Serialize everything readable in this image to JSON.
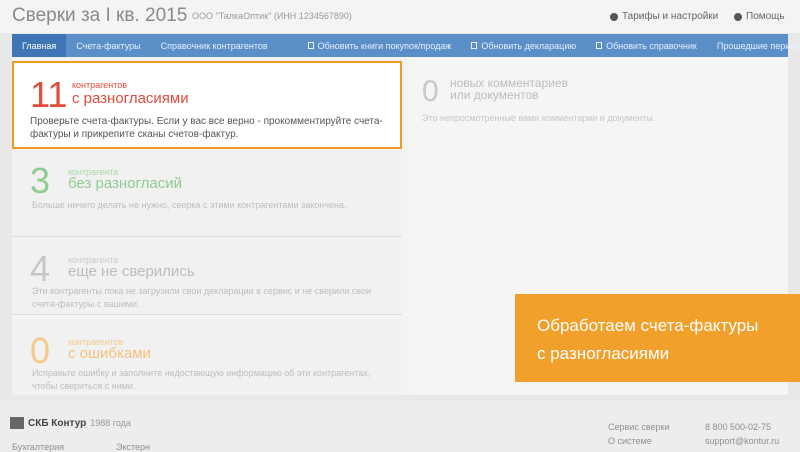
{
  "header": {
    "title": "Сверки за I кв. 2015",
    "org": "ООО \"ТалкаОптик\" (ИНН 1234567890)",
    "tariffs": "Тарифы и настройки",
    "help": "Помощь"
  },
  "nav": {
    "items": [
      "Главная",
      "Счета-фактуры",
      "Справочник контрагентов",
      "Обновить книги покупок/продаж",
      "Обновить декларацию",
      "Обновить справочник",
      "Прошедшие периоды"
    ]
  },
  "cards": [
    {
      "count": "11",
      "label_small": "контрагентов",
      "label_big": "с разногласиями",
      "description": "Проверьте счета-фактуры. Если у вас все верно - прокомментируйте счета-фактуры и прикрепите сканы счетов-фактур."
    },
    {
      "count": "3",
      "label_small": "контрагента",
      "label_big": "без разногласий",
      "description": "Больше ничего делать не нужно, сверка с этими контрагентами закончена."
    },
    {
      "count": "4",
      "label_small": "контрагента",
      "label_big": "еще не сверились",
      "description": "Эти контрагенты пока не загрузили свои декларации в сервис и не сверили свои счета-фактуры с вашими."
    },
    {
      "count": "0",
      "label_small": "контрагентов",
      "label_big": "с ошибками",
      "description": "Исправьте ошибку и заполните недостающую информацию об эти контрагентах, чтобы свериться с ними."
    }
  ],
  "comments": {
    "count": "0",
    "title_line1": "новых комментариев",
    "title_line2": "или документов",
    "description": "Это непросмотренные вами комментарии и документы."
  },
  "callout": {
    "line1": "Обработаем счета-фактуры",
    "line2": "с разногласиями"
  },
  "footer": {
    "brand": "СКБ Контур",
    "since": "1988 года",
    "link1": "Бухгалтерия",
    "link2": "Экстерн",
    "service": "Сервис сверки",
    "about": "О системе",
    "phone": "8 800 500-02-75",
    "email": "support@kontur.ru"
  },
  "colors": {
    "accent_orange": "#f1a02b",
    "nav_blue": "#5b8fc8",
    "disagreement_red": "#e14b3b",
    "ok_green": "#8fcb92"
  }
}
